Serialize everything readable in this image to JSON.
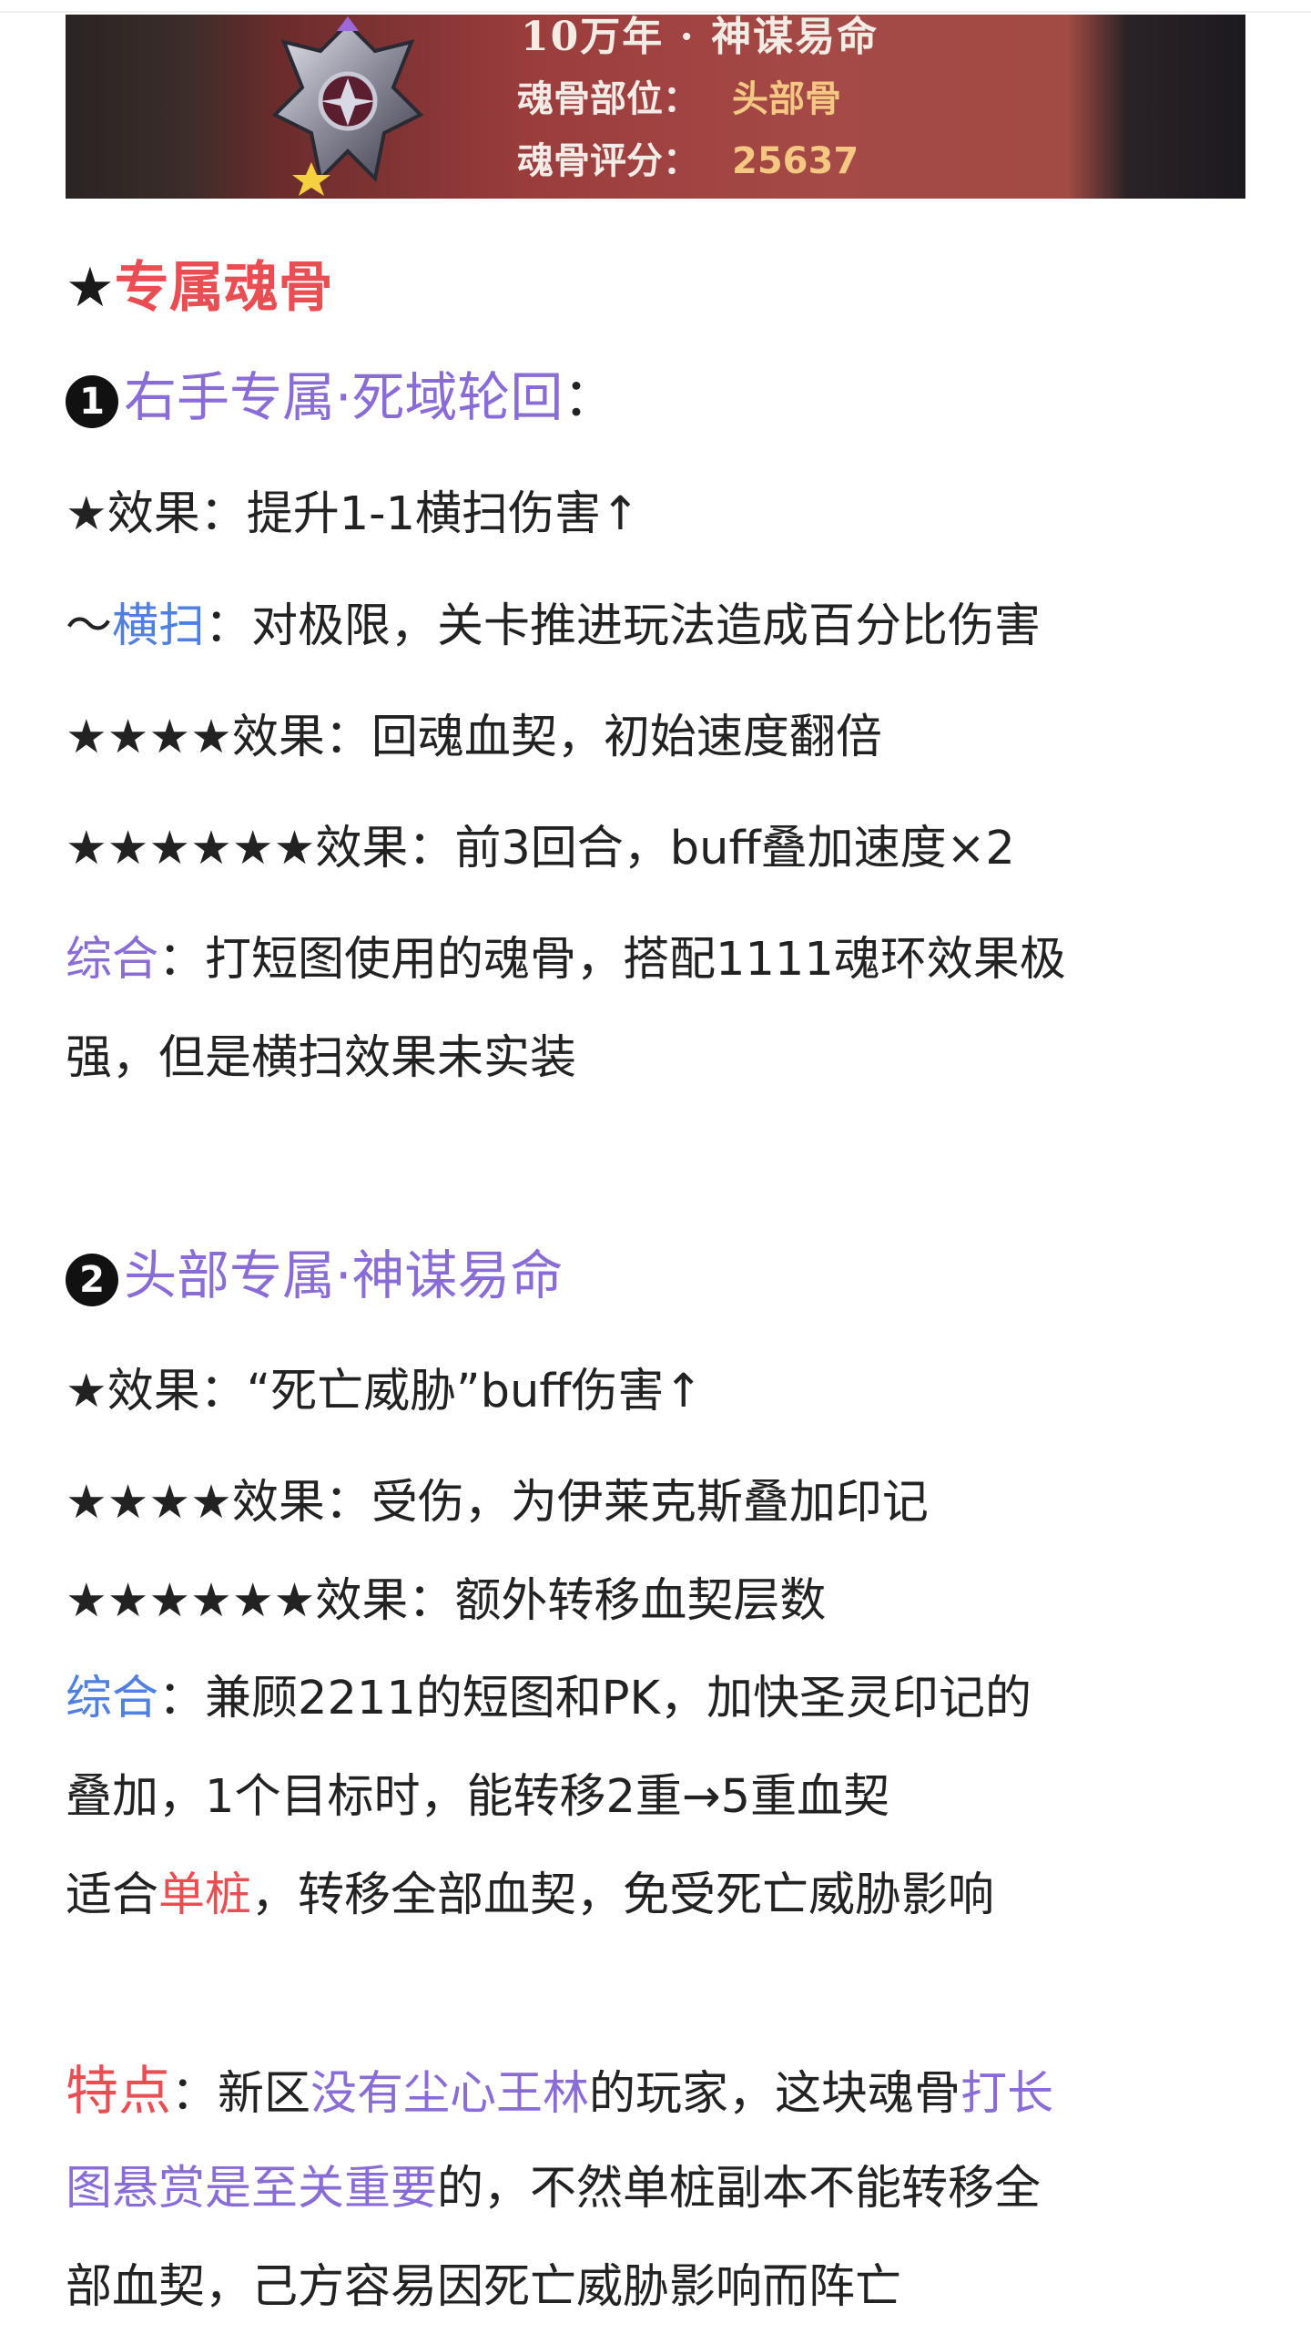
{
  "banner": {
    "title": "10万年 · 神谋易命",
    "position_label": "魂骨部位：",
    "position_value": "头部骨",
    "score_label": "魂骨评分：",
    "score_value": "25637"
  },
  "section": {
    "star": "★",
    "title": "专属魂骨"
  },
  "item1": {
    "badge": "1",
    "name": "右手专属·死域轮回",
    "colon": "：",
    "e1_prefix": "★效果：",
    "e1_text": "提升1-1横扫伤害↑",
    "sweep_prefix": "～",
    "sweep_term": "横扫",
    "sweep_text": "：对极限，关卡推进玩法造成百分比伤害",
    "e4_prefix": "★★★★效果：",
    "e4_text": "回魂血契，初始速度翻倍",
    "e6_prefix": "★★★★★★效果：",
    "e6_text": "前3回合，buff叠加速度×2",
    "sum_term": "综合",
    "sum_line1": "：打短图使用的魂骨，搭配1111魂环效果极",
    "sum_line2": "强，但是横扫效果未实装"
  },
  "item2": {
    "badge": "2",
    "name": "头部专属·神谋易命",
    "e1_prefix": "★效果：",
    "e1_text": "“死亡威胁”buff伤害↑",
    "e4_prefix": "★★★★效果：",
    "e4_text": "受伤，为伊莱克斯叠加印记",
    "e6_prefix": "★★★★★★效果：",
    "e6_text": "额外转移血契层数",
    "sum_term": "综合",
    "sum_line1": "：兼顾2211的短图和PK，加快圣灵印记的",
    "sum_line2": "叠加，1个目标时，能转移2重→5重血契",
    "fit_a": "适合",
    "fit_term": "单桩",
    "fit_b": "，转移全部血契，免受死亡威胁影响"
  },
  "feature": {
    "term": "特点",
    "text_a": "：新区",
    "link1": "没有尘心王林",
    "text_b": "的玩家，这块魂骨",
    "link2a": "打长",
    "link2b": "图悬赏是至关重要",
    "text_c": "的，不然单桩副本不能转移全",
    "line3": "部血契，己方容易因死亡威胁影响而阵亡"
  },
  "colors": {
    "red": "#ea4d52",
    "purple": "#8a6cd6",
    "blue": "#4f7fe0"
  }
}
